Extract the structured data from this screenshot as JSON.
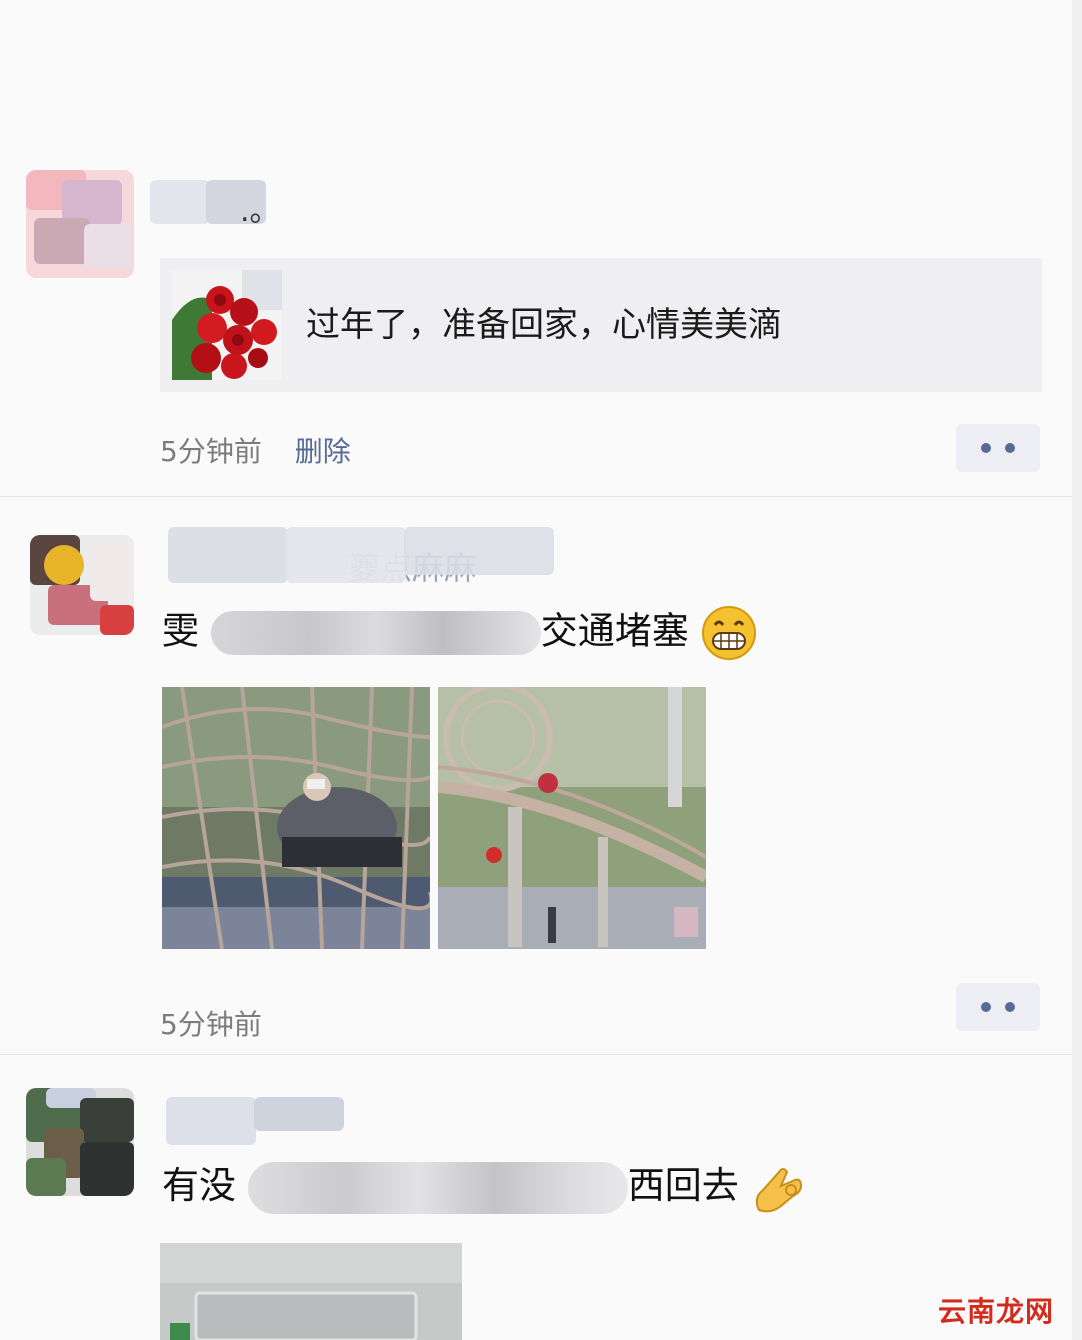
{
  "posts": [
    {
      "name_tail": ".。",
      "share": {
        "title": "过年了，准备回家，心情美美滴"
      },
      "time": "5分钟前",
      "delete_label": "删除"
    },
    {
      "name_partial": "夔点麻麻",
      "text_start": "雯",
      "text_end": "交通堵塞",
      "emoji": "grin-emoji",
      "time": "5分钟前"
    },
    {
      "text_start": "有没",
      "text_end": "西回去",
      "emoji": "ok-hand-emoji"
    }
  ],
  "watermark": "云南龙网",
  "colors": {
    "link": "#576b95",
    "card_bg": "#efeff1",
    "page_bg": "#fafafa"
  }
}
